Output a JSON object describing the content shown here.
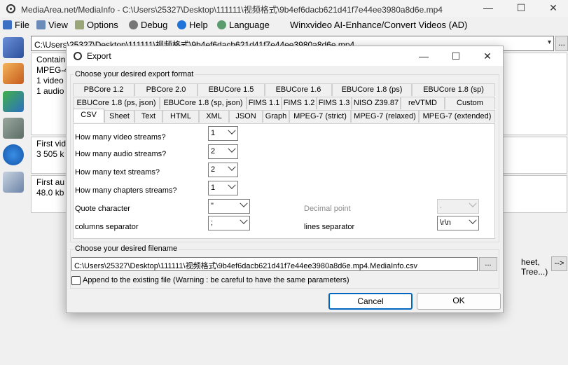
{
  "window": {
    "title": "MediaArea.net/MediaInfo - C:\\Users\\25327\\Desktop\\111111\\视频格式\\9b4ef6dacb621d41f7e44ee3980a8d6e.mp4",
    "minimize": "—",
    "maximize": "☐",
    "close": "✕"
  },
  "menu": {
    "file": "File",
    "view": "View",
    "options": "Options",
    "debug": "Debug",
    "help": "Help",
    "language": "Language",
    "winx": "Winxvideo AI-Enhance/Convert Videos (AD)"
  },
  "path": {
    "value": "C:\\Users\\25327\\Desktop\\111111\\视频格式\\9b4ef6dacb621d41f7e44ee3980a8d6e.mp4",
    "more": "..."
  },
  "background": {
    "container_label": "Contain",
    "format": "MPEG-4",
    "video_count": "1 video s",
    "audio_count": "1 audio",
    "first_video_label": "First vid",
    "first_video_value": "3 505 k",
    "first_audio_label": "First au",
    "first_audio_value": "48.0 kb",
    "tree_text": "heet, Tree...)",
    "go_button": "-->"
  },
  "dialog": {
    "title": "Export",
    "format_group_label": "Choose your desired export format",
    "tabs_row1": [
      "PBCore 1.2",
      "PBCore 2.0",
      "EBUCore 1.5",
      "EBUCore 1.6",
      "EBUCore 1.8 (ps)",
      "EBUCore 1.8 (sp)"
    ],
    "tabs_row2": [
      "EBUCore 1.8 (ps, json)",
      "EBUCore 1.8 (sp, json)",
      "FIMS 1.1",
      "FIMS 1.2",
      "FIMS 1.3",
      "NISO Z39.87",
      "reVTMD",
      "Custom"
    ],
    "tabs_row3": [
      "CSV",
      "Sheet",
      "Text",
      "HTML",
      "XML",
      "JSON",
      "Graph",
      "MPEG-7 (strict)",
      "MPEG-7 (relaxed)",
      "MPEG-7 (extended)"
    ],
    "active_tab": "CSV",
    "fields": {
      "video_streams_label": "How many video streams?",
      "video_streams_value": "1",
      "audio_streams_label": "How many audio streams?",
      "audio_streams_value": "2",
      "text_streams_label": "How many text streams?",
      "text_streams_value": "2",
      "chapter_streams_label": "How many chapters streams?",
      "chapter_streams_value": "1",
      "quote_label": "Quote character",
      "quote_value": "\"",
      "decimal_label": "Decimal point",
      "decimal_value": ".",
      "column_sep_label": "columns separator",
      "column_sep_value": ";",
      "line_sep_label": "lines separator",
      "line_sep_value": "\\r\\n"
    },
    "filename_group_label": "Choose your desired filename",
    "filename_value": "C:\\Users\\25327\\Desktop\\111111\\视频格式\\9b4ef6dacb621d41f7e44ee3980a8d6e.mp4.MediaInfo.csv",
    "browse": "...",
    "append_label": "Append to the existing file (Warning : be careful to have the same parameters)",
    "cancel": "Cancel",
    "ok": "OK"
  }
}
